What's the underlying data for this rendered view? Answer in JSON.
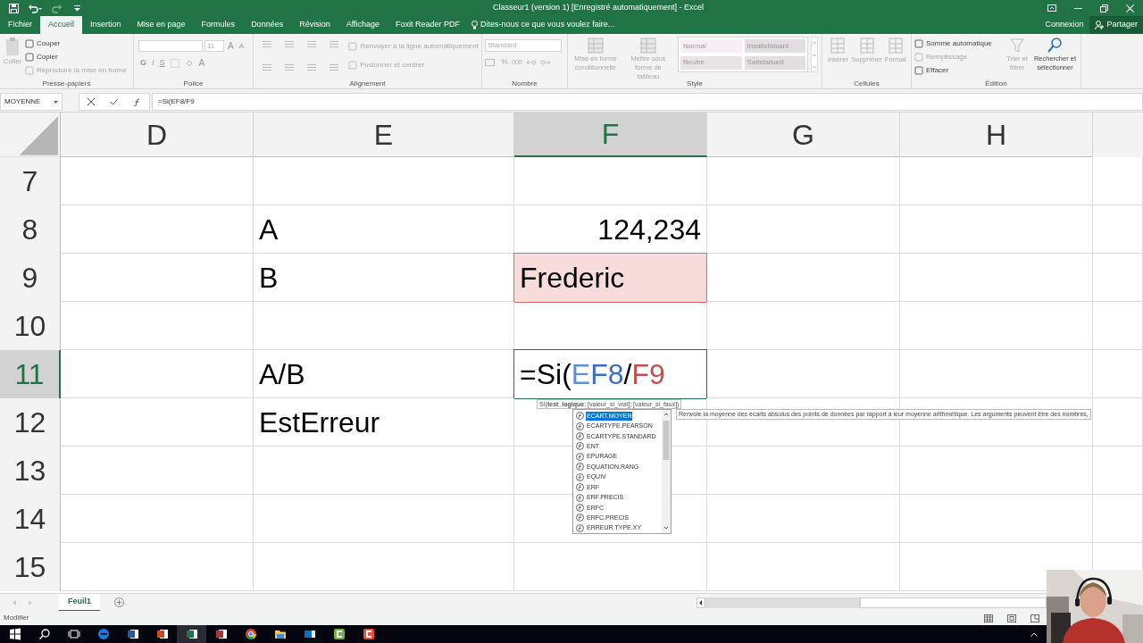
{
  "window": {
    "title": "Classeur1 (version 1) [Enregistré automatiquement] - Excel"
  },
  "ribbon_tabs": [
    {
      "label": "Fichier",
      "selected": false
    },
    {
      "label": "Accueil",
      "selected": true
    },
    {
      "label": "Insertion",
      "selected": false
    },
    {
      "label": "Mise en page",
      "selected": false
    },
    {
      "label": "Formules",
      "selected": false
    },
    {
      "label": "Données",
      "selected": false
    },
    {
      "label": "Révision",
      "selected": false
    },
    {
      "label": "Affichage",
      "selected": false
    },
    {
      "label": "Foxit Reader PDF",
      "selected": false
    }
  ],
  "tell_me": "Dites-nous ce que vous voulez faire...",
  "account": {
    "sign_in": "Connexion",
    "share": "Partager"
  },
  "ribbon": {
    "clipboard": {
      "label": "Presse-papiers",
      "paste": {
        "label": "Coller",
        "disabled": true
      },
      "commands": [
        {
          "label": "Couper",
          "disabled": false
        },
        {
          "label": "Copier",
          "disabled": false
        },
        {
          "label": "Reproduire la mise en forme",
          "disabled": true
        }
      ]
    },
    "font": {
      "label": "Police",
      "size": "11",
      "grow": "A",
      "shrink": "A",
      "styles": [
        "G",
        "I",
        "S"
      ],
      "font_color": "A"
    },
    "alignment": {
      "label": "Alignement",
      "commands": [
        {
          "label": "Renvoyer à la ligne automatiquement",
          "disabled": true
        },
        {
          "label": "Fusionner et centrer",
          "disabled": true
        }
      ]
    },
    "number": {
      "label": "Nombre",
      "format": "Standard",
      "percent": "%",
      "thousands": "000"
    },
    "styles": {
      "label": "Style",
      "commands": [
        {
          "label": "Mise en forme conditionnelle",
          "disabled": true
        },
        {
          "label": "Mettre sous forme de tableau",
          "disabled": true
        }
      ],
      "gallery": [
        {
          "label": "Normal",
          "color": "#f6eef4"
        },
        {
          "label": "Insatisfaisant",
          "color": "#e2dde0"
        },
        {
          "label": "Neutre",
          "color": "#e9e3e7"
        },
        {
          "label": "Satisfaisant",
          "color": "#e2dde0"
        }
      ]
    },
    "cells": {
      "label": "Cellules",
      "commands": [
        {
          "label": "Insérer",
          "disabled": true
        },
        {
          "label": "Supprimer",
          "disabled": true
        },
        {
          "label": "Format",
          "disabled": true
        }
      ]
    },
    "editing": {
      "label": "Édition",
      "commands": [
        {
          "label": "Somme automatique",
          "disabled": false
        },
        {
          "label": "Remplissage",
          "disabled": true
        },
        {
          "label": "Effacer",
          "disabled": false
        }
      ],
      "large": [
        {
          "label": "Trier et filtrer",
          "disabled": true
        },
        {
          "label": "Rechercher et sélectionner",
          "disabled": false
        }
      ]
    }
  },
  "formula_bar": {
    "name_box": "MOYENNE",
    "formula": "=Si(EF8/F9"
  },
  "grid": {
    "columns": [
      {
        "label": "D",
        "selected": false
      },
      {
        "label": "E",
        "selected": false
      },
      {
        "label": "F",
        "selected": true
      },
      {
        "label": "G",
        "selected": false
      },
      {
        "label": "H",
        "selected": false
      }
    ],
    "rows": [
      {
        "number": "7",
        "selected": false,
        "cells": [
          {
            "kind": "empty"
          },
          {
            "kind": "empty"
          },
          {
            "kind": "empty"
          },
          {
            "kind": "empty"
          },
          {
            "kind": "empty"
          }
        ]
      },
      {
        "number": "8",
        "selected": false,
        "cells": [
          {
            "kind": "empty"
          },
          {
            "kind": "text",
            "text": "A"
          },
          {
            "kind": "number",
            "text": "124,234"
          },
          {
            "kind": "empty"
          },
          {
            "kind": "empty"
          }
        ]
      },
      {
        "number": "9",
        "selected": false,
        "cells": [
          {
            "kind": "empty"
          },
          {
            "kind": "text",
            "text": "B"
          },
          {
            "kind": "highlighted",
            "text": "Frederic"
          },
          {
            "kind": "empty"
          },
          {
            "kind": "empty"
          }
        ]
      },
      {
        "number": "10",
        "selected": false,
        "cells": [
          {
            "kind": "empty"
          },
          {
            "kind": "empty"
          },
          {
            "kind": "empty"
          },
          {
            "kind": "empty"
          },
          {
            "kind": "empty"
          }
        ]
      },
      {
        "number": "11",
        "selected": true,
        "cells": [
          {
            "kind": "empty"
          },
          {
            "kind": "text",
            "text": "A/B"
          },
          {
            "kind": "editing",
            "segments": [
              {
                "text": "=Si(",
                "color": "#000000"
              },
              {
                "text": "E",
                "color": "#5b8fd6"
              },
              {
                "text": "F8",
                "color": "#3d6cc4"
              },
              {
                "text": "/",
                "color": "#000000"
              },
              {
                "text": "F9",
                "color": "#c0504d"
              }
            ]
          },
          {
            "kind": "empty"
          },
          {
            "kind": "empty"
          }
        ]
      },
      {
        "number": "12",
        "selected": false,
        "cells": [
          {
            "kind": "empty"
          },
          {
            "kind": "text",
            "text": "EstErreur"
          },
          {
            "kind": "empty"
          },
          {
            "kind": "empty"
          },
          {
            "kind": "empty"
          }
        ]
      },
      {
        "number": "13",
        "selected": false,
        "cells": [
          {
            "kind": "empty"
          },
          {
            "kind": "empty"
          },
          {
            "kind": "empty"
          },
          {
            "kind": "empty"
          },
          {
            "kind": "empty"
          }
        ]
      },
      {
        "number": "14",
        "selected": false,
        "cells": [
          {
            "kind": "empty"
          },
          {
            "kind": "empty"
          },
          {
            "kind": "empty"
          },
          {
            "kind": "empty"
          },
          {
            "kind": "empty"
          }
        ]
      },
      {
        "number": "15",
        "selected": false,
        "cells": [
          {
            "kind": "empty"
          },
          {
            "kind": "empty"
          },
          {
            "kind": "empty"
          },
          {
            "kind": "empty"
          },
          {
            "kind": "empty"
          }
        ]
      }
    ]
  },
  "autocomplete": {
    "hint": "SI(**test_logique**; [valeur_si_vrai]; [valeur_si_faux])",
    "items": [
      {
        "label": "ECART.MOYEN",
        "selected": true
      },
      {
        "label": "ECARTYPE.PEARSON",
        "selected": false
      },
      {
        "label": "ECARTYPE.STANDARD",
        "selected": false
      },
      {
        "label": "ENT",
        "selected": false
      },
      {
        "label": "EPURAGE",
        "selected": false
      },
      {
        "label": "EQUATION.RANG",
        "selected": false
      },
      {
        "label": "EQUIV",
        "selected": false
      },
      {
        "label": "ERF",
        "selected": false
      },
      {
        "label": "ERF.PRECIS",
        "selected": false
      },
      {
        "label": "ERFC",
        "selected": false
      },
      {
        "label": "ERFC.PRECIS",
        "selected": false
      },
      {
        "label": "ERREUR.TYPE.XY",
        "selected": false
      }
    ],
    "description": "Renvoie la moyenne des écarts absolus des points de données par rapport à leur moyenne arithmétique. Les arguments peuvent être des nombres,"
  },
  "sheet_tabs": [
    {
      "label": "Feuil1",
      "selected": true
    }
  ],
  "status_bar": {
    "mode": "Modifier"
  }
}
